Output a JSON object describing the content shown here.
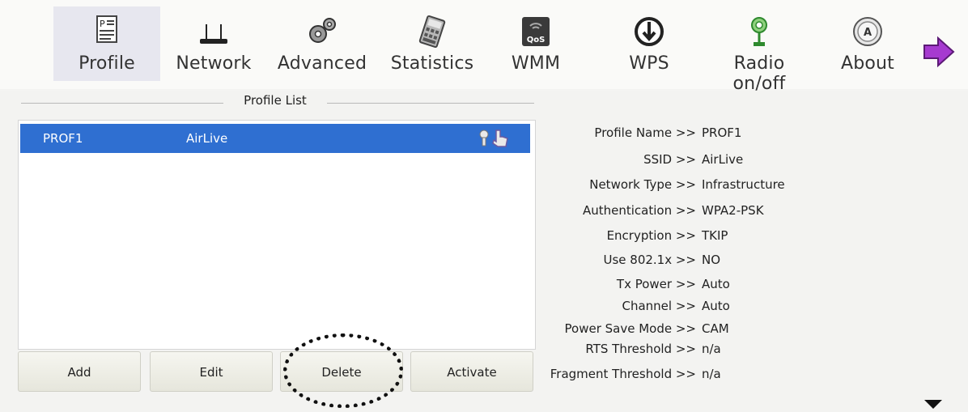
{
  "toolbar": {
    "items": [
      {
        "label": "Profile",
        "icon": "profile-icon",
        "active": true
      },
      {
        "label": "Network",
        "icon": "network-router-icon"
      },
      {
        "label": "Advanced",
        "icon": "gears-icon"
      },
      {
        "label": "Statistics",
        "icon": "statistics-calculator-icon"
      },
      {
        "label": "WMM",
        "icon": "qos-icon",
        "icon_text": "QoS"
      },
      {
        "label": "WPS",
        "icon": "wps-icon"
      },
      {
        "label": "Radio on/off",
        "icon": "radio-antenna-icon"
      },
      {
        "label": "About",
        "icon": "about-icon"
      }
    ],
    "next_icon": "right-arrow-icon"
  },
  "profile_list": {
    "title": "Profile List",
    "rows": [
      {
        "profile": "PROF1",
        "ssid": "AirLive",
        "selected": true
      }
    ]
  },
  "buttons": {
    "add": "Add",
    "edit": "Edit",
    "delete": "Delete",
    "activate": "Activate"
  },
  "details": [
    {
      "key": "Profile Name >>",
      "value": "PROF1"
    },
    {
      "key": "SSID >>",
      "value": "AirLive"
    },
    {
      "key": "Network Type >>",
      "value": "Infrastructure"
    },
    {
      "key": "Authentication >>",
      "value": "WPA2-PSK"
    },
    {
      "key": "Encryption >>",
      "value": "TKIP"
    },
    {
      "key": "Use 802.1x >>",
      "value": "NO"
    },
    {
      "key": "Tx Power >>",
      "value": "Auto"
    },
    {
      "key": "Channel >>",
      "value": "Auto"
    },
    {
      "key": "Power Save Mode >>",
      "value": "CAM"
    },
    {
      "key": "RTS Threshold >>",
      "value": "n/a"
    },
    {
      "key": "Fragment Threshold >>",
      "value": "n/a"
    }
  ],
  "colors": {
    "selection": "#2f6fd1",
    "highlight_ring": "#111111",
    "next_arrow": "#a63ad0"
  }
}
